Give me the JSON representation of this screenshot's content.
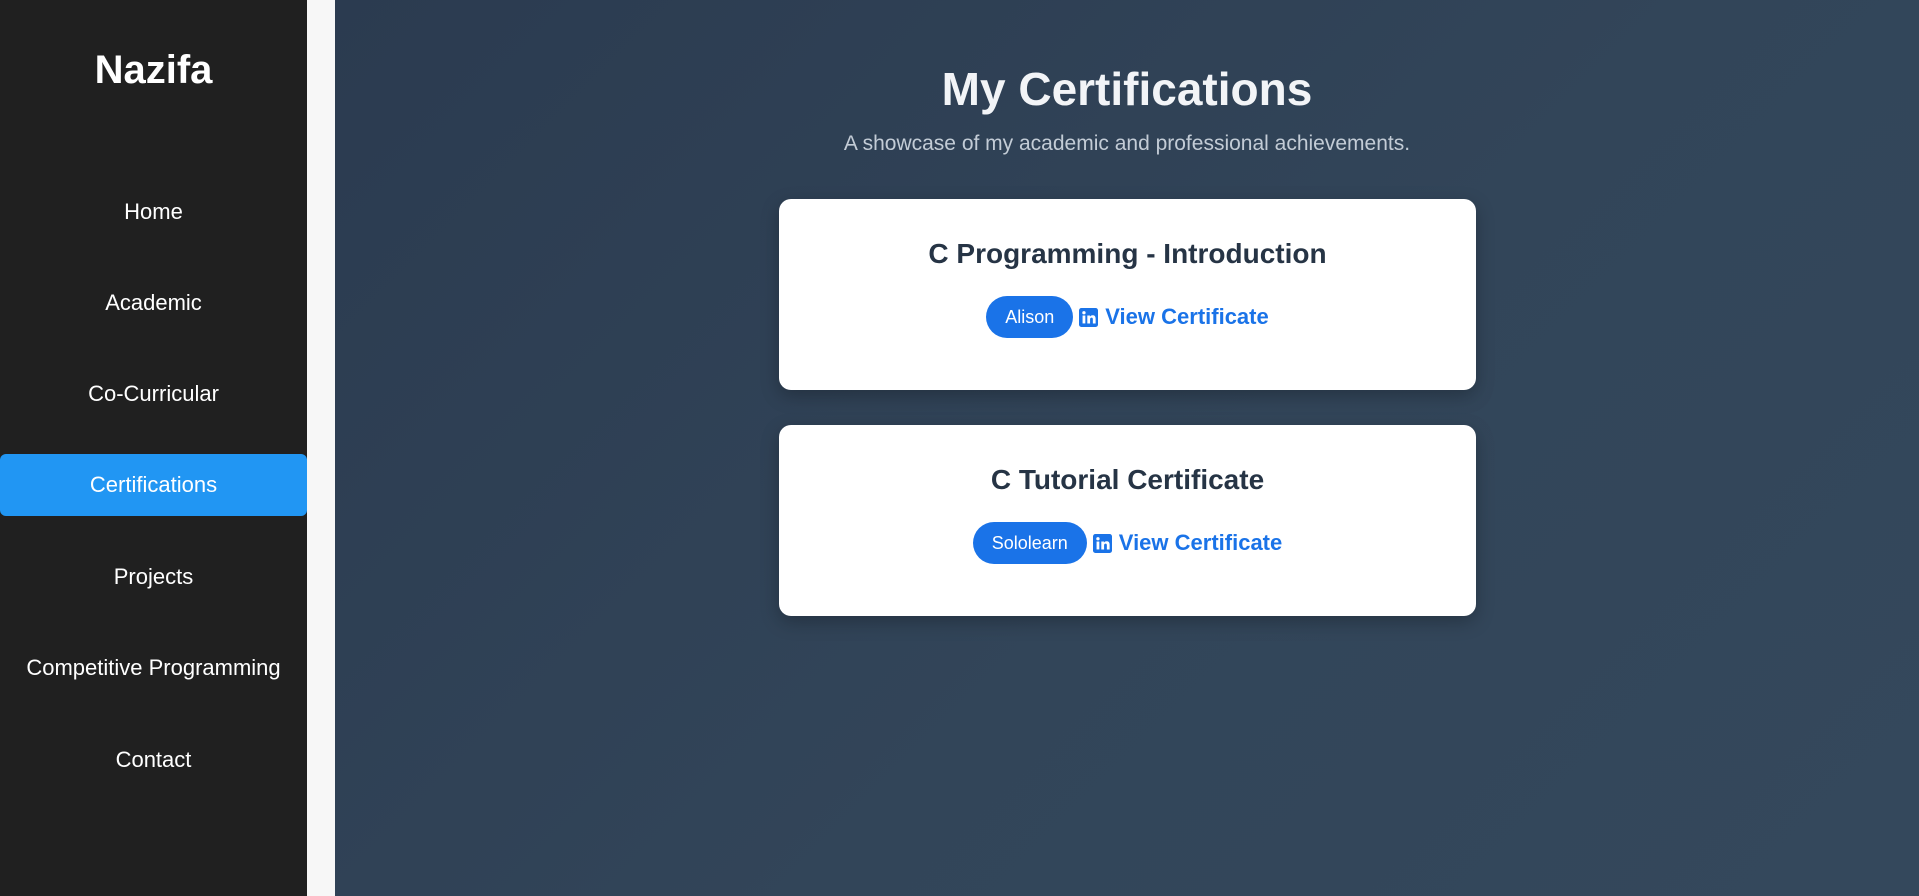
{
  "sidebar": {
    "brand": "Nazifa",
    "items": [
      {
        "label": "Home",
        "active": false
      },
      {
        "label": "Academic",
        "active": false
      },
      {
        "label": "Co-Curricular",
        "active": false
      },
      {
        "label": "Certifications",
        "active": true
      },
      {
        "label": "Projects",
        "active": false
      },
      {
        "label": "Competitive Programming",
        "active": false
      },
      {
        "label": "Contact",
        "active": false
      }
    ]
  },
  "main": {
    "title": "My Certifications",
    "subtitle": "A showcase of my academic and professional achievements.",
    "certifications": [
      {
        "title": "C Programming - Introduction",
        "issuer": "Alison",
        "link_icon": "linkedin-icon",
        "link_label": "View Certificate"
      },
      {
        "title": "C Tutorial Certificate",
        "issuer": "Sololearn",
        "link_icon": "linkedin-icon",
        "link_label": "View Certificate"
      }
    ]
  },
  "colors": {
    "sidebar_bg": "#202020",
    "active_nav": "#2196f3",
    "main_bg": "#2f4156",
    "accent": "#1a73e8",
    "card_title": "#263445"
  }
}
